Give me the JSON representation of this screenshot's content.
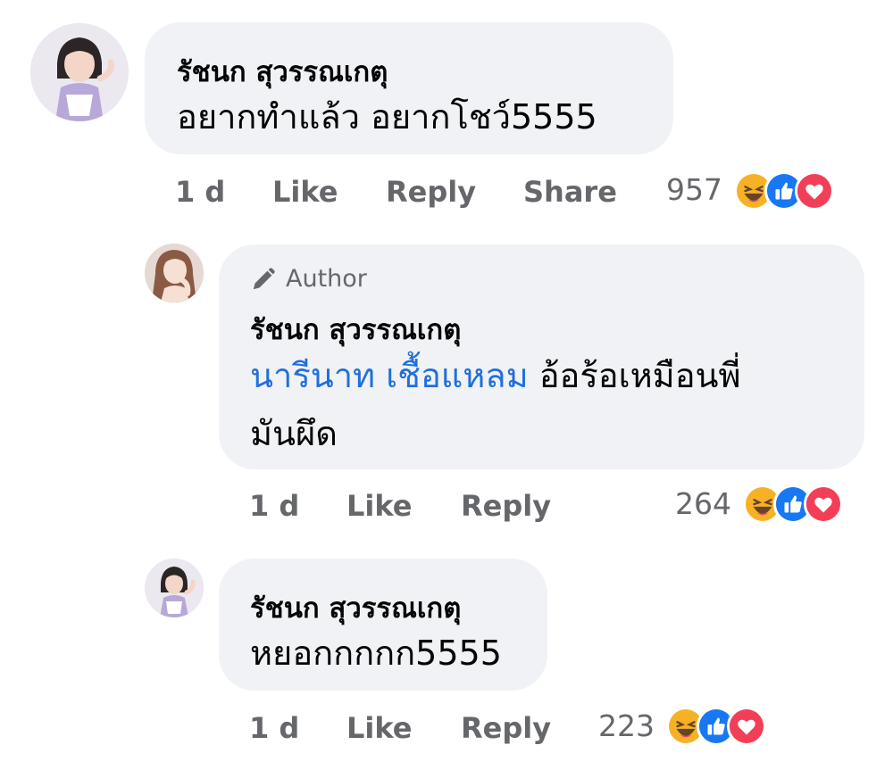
{
  "comments": [
    {
      "author": "รัชนก สุวรรณเกตุ",
      "text": "อยากทำแล้ว อยากโชว์5555",
      "time": "1 d",
      "like_label": "Like",
      "reply_label": "Reply",
      "share_label": "Share",
      "reaction_count": "957",
      "reactions": [
        "haha-icon",
        "like-icon",
        "love-icon"
      ]
    }
  ],
  "replies": [
    {
      "badge": "Author",
      "author": "รัชนก สุวรรณเกตุ",
      "mention": "นารีนาท เชื้อแหลม",
      "text_line1": " อ้อร้อเหมือนพี่",
      "text_line2": "มันผึด",
      "time": "1 d",
      "like_label": "Like",
      "reply_label": "Reply",
      "reaction_count": "264",
      "reactions": [
        "haha-icon",
        "like-icon",
        "love-icon"
      ]
    },
    {
      "author": "รัชนก สุวรรณเกตุ",
      "text": "หยอกกกกก5555",
      "time": "1 d",
      "like_label": "Like",
      "reply_label": "Reply",
      "reaction_count": "223",
      "reactions": [
        "haha-icon",
        "like-icon",
        "love-icon"
      ]
    }
  ],
  "colors": {
    "bubble": "#f0f2f5",
    "meta_text": "#65676b",
    "mention": "#216fdb",
    "like_blue": "#1877f2",
    "love_red": "#f33e58",
    "haha_yellow": "#f7b125"
  }
}
